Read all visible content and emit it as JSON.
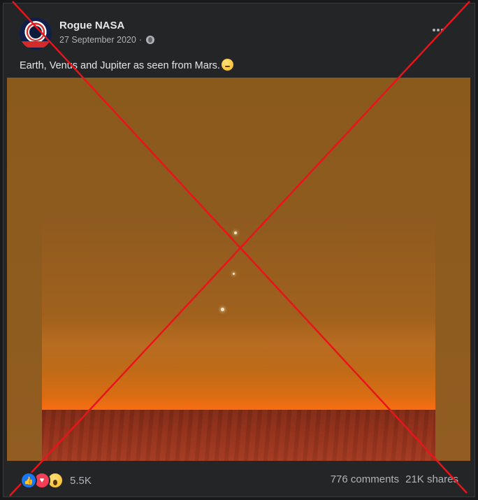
{
  "post": {
    "page_name": "Rogue NASA",
    "date": "27 September 2020",
    "separator": "·",
    "caption": "Earth, Venus and Jupiter as seen from Mars."
  },
  "footer": {
    "reaction_count": "5.5K",
    "comments": "776 comments",
    "shares": "21K shares"
  },
  "icons": {
    "avatar": "rogue-nasa-logo",
    "audience": "globe-icon",
    "menu": "more-options-icon",
    "caption_emoji": "thinking-face-emoji",
    "reactions": [
      "like-icon",
      "love-icon",
      "wow-icon"
    ]
  },
  "colors": {
    "background": "#18191a",
    "card": "#242526",
    "text_primary": "#e4e6eb",
    "text_secondary": "#b0b3b8",
    "cross": "#e8141b",
    "like": "#1877f2",
    "love": "#f33e58"
  }
}
